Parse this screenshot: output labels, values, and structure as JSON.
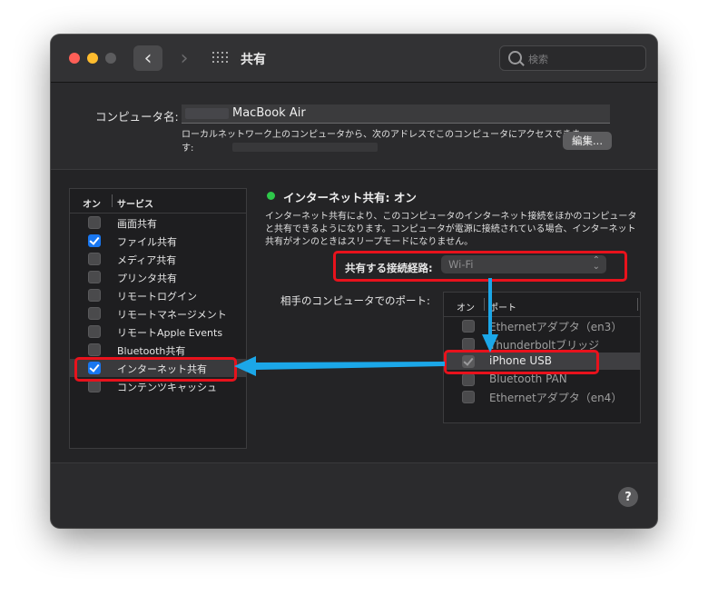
{
  "window": {
    "title": "共有"
  },
  "search": {
    "placeholder": "検索"
  },
  "computer_name": {
    "label": "コンピュータ名:",
    "value": "MacBook Air",
    "address_text": "ローカルネットワーク上のコンピュータから、次のアドレスでこのコンピュータにアクセスできます:",
    "edit_label": "編集..."
  },
  "services": {
    "header_on": "オン",
    "header_service": "サービス",
    "items": [
      {
        "label": "画面共有",
        "checked": false
      },
      {
        "label": "ファイル共有",
        "checked": true
      },
      {
        "label": "メディア共有",
        "checked": false
      },
      {
        "label": "プリンタ共有",
        "checked": false
      },
      {
        "label": "リモートログイン",
        "checked": false
      },
      {
        "label": "リモートマネージメント",
        "checked": false
      },
      {
        "label": "リモートApple Events",
        "checked": false
      },
      {
        "label": "Bluetooth共有",
        "checked": false
      },
      {
        "label": "インターネット共有",
        "checked": true,
        "selected": true
      },
      {
        "label": "コンテンツキャッシュ",
        "checked": false
      }
    ]
  },
  "detail": {
    "status": "インターネット共有: オン",
    "status_color": "#2ec84a",
    "description": "インターネット共有により、このコンピュータのインターネット接続をほかのコンピュータと共有できるようになります。コンピュータが電源に接続されている場合、インターネット共有がオンのときはスリープモードになりません。",
    "connection_label": "共有する接続経路:",
    "connection_value": "Wi-Fi",
    "ports_label": "相手のコンピュータでのポート:",
    "ports_header_on": "オン",
    "ports_header_port": "ポート",
    "ports": [
      {
        "label": "Ethernetアダプタ（en3）",
        "checked": false
      },
      {
        "label": "Thunderboltブリッジ",
        "checked": false
      },
      {
        "label": "iPhone USB",
        "checked": true,
        "selected": true
      },
      {
        "label": "Bluetooth PAN",
        "checked": false
      },
      {
        "label": "Ethernetアダプタ（en4）",
        "checked": false
      }
    ]
  },
  "help": {
    "label": "?"
  },
  "colors": {
    "accent": "#1977f0",
    "annotation_box": "#e8121c",
    "annotation_arrow": "#1ba7e8"
  }
}
